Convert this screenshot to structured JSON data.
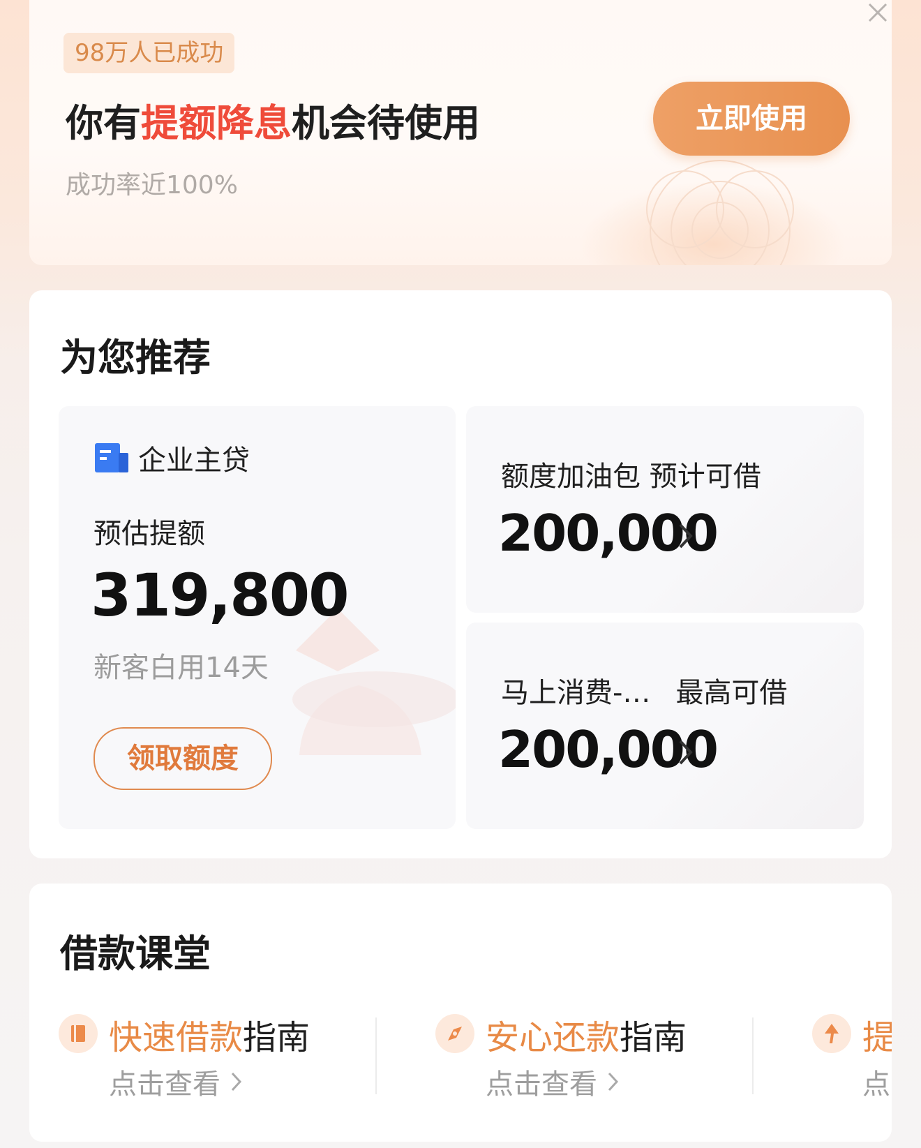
{
  "banner": {
    "badge": "98万人已成功",
    "title_pre": "你有",
    "title_highlight": "提额降息",
    "title_post": "机会待使用",
    "subtitle": "成功率近100%",
    "button": "立即使用",
    "highlight_color": "#ef4b3a",
    "accent_color": "#e8904f"
  },
  "recommend": {
    "title": "为您推荐",
    "main": {
      "product": "企业主贷",
      "label": "预估提额",
      "amount": "319,800",
      "note": "新客白用14天",
      "button": "领取额度"
    },
    "cards": [
      {
        "name": "额度加油包",
        "label": "预计可借",
        "amount": "200,000"
      },
      {
        "name": "马上消费-…",
        "label": "最高可借",
        "amount": "200,000"
      }
    ]
  },
  "classroom": {
    "title": "借款课堂",
    "items": [
      {
        "highlight": "快速借款",
        "rest": "指南",
        "sub": "点击查看",
        "icon": "book-icon"
      },
      {
        "highlight": "安心还款",
        "rest": "指南",
        "sub": "点击查看",
        "icon": "compass-icon"
      },
      {
        "highlight": "提",
        "rest": "",
        "sub": "点",
        "icon": "arrow-up-icon"
      }
    ]
  }
}
